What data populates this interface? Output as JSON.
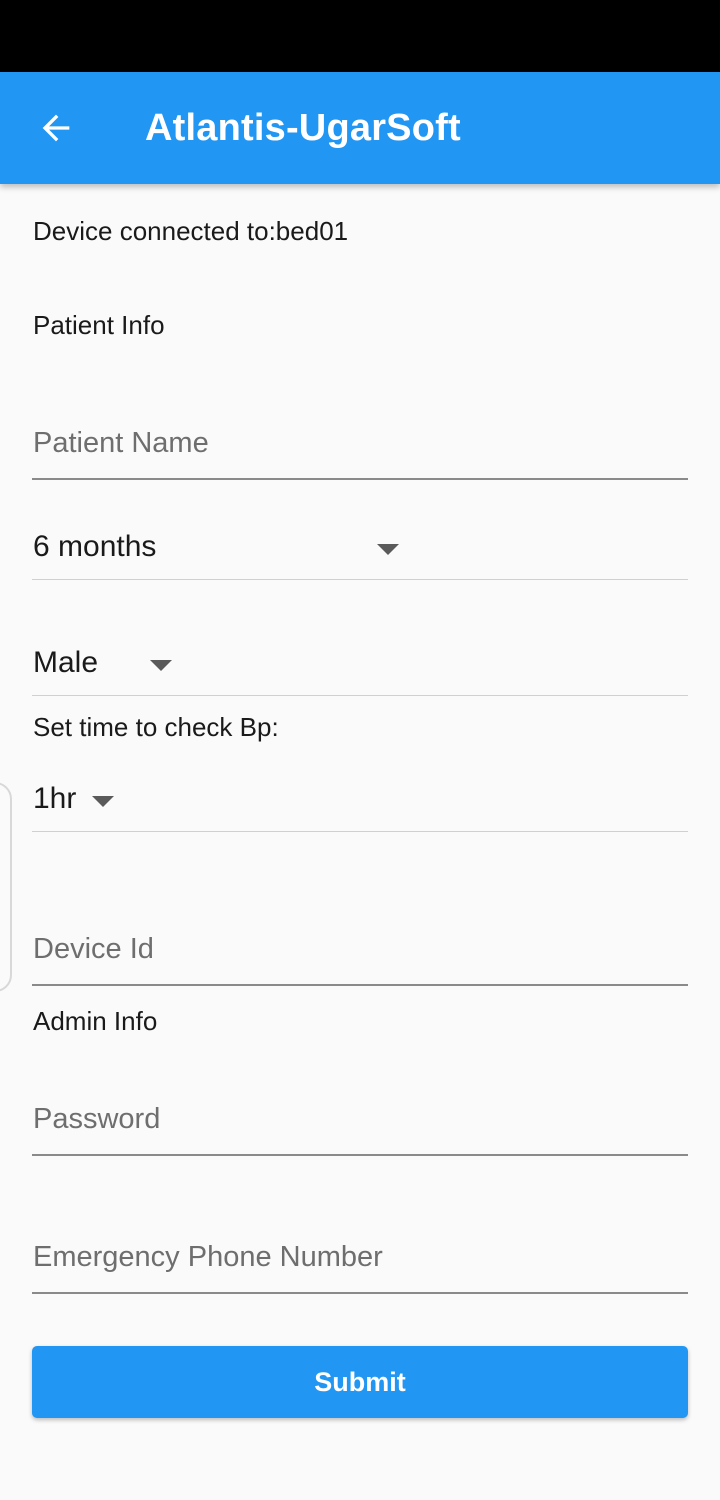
{
  "app_bar": {
    "title": "Atlantis-UgarSoft",
    "back_icon": "arrow-left-icon",
    "color": "#2196f3"
  },
  "form": {
    "device_connected": "Device connected to:bed01",
    "patient_section_label": "Patient Info",
    "patient_name": {
      "value": "",
      "placeholder": "Patient Name"
    },
    "age": {
      "selected": "6 months"
    },
    "gender": {
      "selected": "Male"
    },
    "bp_check_label": "Set time to check Bp:",
    "bp_interval": {
      "selected": "1hr"
    },
    "device_id": {
      "value": "",
      "placeholder": "Device Id"
    },
    "admin_section_label": "Admin Info",
    "password": {
      "value": "",
      "placeholder": "Password"
    },
    "emergency_phone": {
      "value": "",
      "placeholder": "Emergency Phone Number"
    },
    "submit_label": "Submit"
  },
  "icons": {
    "dropdown": "caret-down-icon"
  }
}
